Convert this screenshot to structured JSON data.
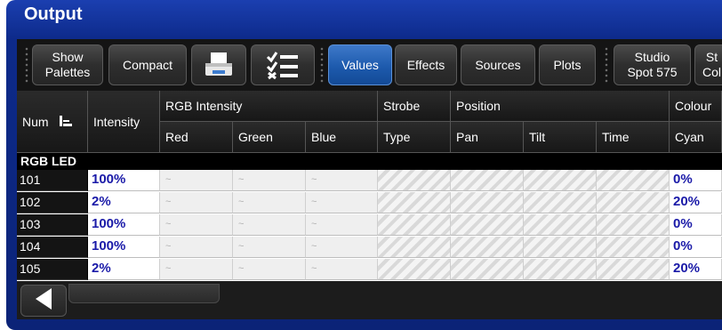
{
  "window": {
    "title": "Output"
  },
  "toolbar": {
    "show_palettes": "Show\nPalettes",
    "compact": "Compact",
    "print_icon": "printer-icon",
    "checklist_icon": "checklist-icon",
    "values": "Values",
    "effects": "Effects",
    "sources": "Sources",
    "plots": "Plots",
    "studio_spot": "Studio\nSpot 575",
    "studio_colour_partial": "St\nCol"
  },
  "table": {
    "num_header": "Num",
    "intensity_header": "Intensity",
    "group_headers": {
      "rgb_intensity": "RGB Intensity",
      "strobe": "Strobe",
      "position": "Position",
      "colour": "Colour"
    },
    "sub_headers": {
      "red": "Red",
      "green": "Green",
      "blue": "Blue",
      "type": "Type",
      "pan": "Pan",
      "tilt": "Tilt",
      "time": "Time",
      "cyan": "Cyan"
    },
    "group_label": "RGB LED",
    "rows": [
      {
        "num": "101",
        "intensity": "100%",
        "red": "~",
        "green": "~",
        "blue": "~",
        "cyan": "0%"
      },
      {
        "num": "102",
        "intensity": "2%",
        "red": "~",
        "green": "~",
        "blue": "~",
        "cyan": "20%"
      },
      {
        "num": "103",
        "intensity": "100%",
        "red": "~",
        "green": "~",
        "blue": "~",
        "cyan": "0%"
      },
      {
        "num": "104",
        "intensity": "100%",
        "red": "~",
        "green": "~",
        "blue": "~",
        "cyan": "0%"
      },
      {
        "num": "105",
        "intensity": "2%",
        "red": "~",
        "green": "~",
        "blue": "~",
        "cyan": "20%"
      }
    ]
  },
  "colors": {
    "frame": "#0d2a8a",
    "active_button": "#1d5aad",
    "value_text": "#1a1aa8"
  }
}
